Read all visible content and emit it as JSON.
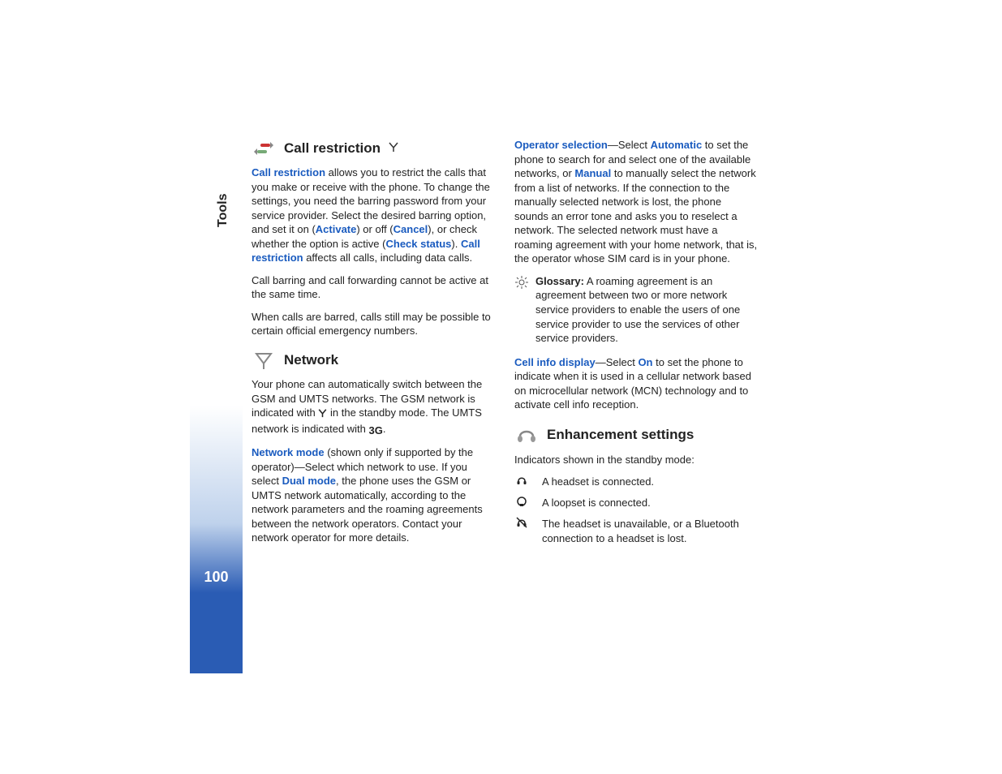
{
  "sidebar": {
    "section_label": "Tools",
    "page_number": "100"
  },
  "left_col": {
    "h1": "Call restriction",
    "p1_lead": "Call restriction",
    "p1_a": " allows you to restrict the calls that you make or receive with the phone. To change the settings, you need the barring password from your service provider. Select the desired barring option, and set it on (",
    "p1_activate": "Activate",
    "p1_b": ") or off (",
    "p1_cancel": "Cancel",
    "p1_c": "), or check whether the option is active (",
    "p1_check": "Check status",
    "p1_d": "). ",
    "p1_restr2": "Call restriction",
    "p1_e": " affects all calls, including data calls.",
    "p2": "Call barring and call forwarding cannot be active at the same time.",
    "p3": "When calls are barred, calls still may be possible to certain official emergency numbers.",
    "h2": "Network",
    "p4_a": "Your phone can automatically switch between the GSM and UMTS networks. The GSM network is indicated with ",
    "p4_b": " in the standby mode. The UMTS network is indicated with ",
    "p4_3g": "3G",
    "p4_c": ".",
    "p5_lead": "Network mode",
    "p5_a": " (shown only if supported by the operator)—Select which network to use. If you select ",
    "p5_dual": "Dual mode",
    "p5_b": ", the phone uses the GSM or UMTS network automatically, according to the network parameters and the roaming agreements between the network operators. Contact your network operator for more details."
  },
  "right_col": {
    "p1_lead": "Operator selection",
    "p1_a": "—Select ",
    "p1_auto": "Automatic",
    "p1_b": " to set the phone to search for and select one of the available networks, or ",
    "p1_manual": "Manual",
    "p1_c": " to manually select the network from a list of networks. If the connection to the manually selected network is lost, the phone sounds an error tone and asks you to reselect a network. The selected network must have a roaming agreement with your home network, that is, the operator whose SIM card is in your phone.",
    "gloss_label": "Glossary:",
    "gloss_text": " A roaming agreement is an agreement between two or more network service providers to enable the users of one service provider to use the services of other service providers.",
    "p2_lead": "Cell info display",
    "p2_a": "—Select ",
    "p2_on": "On",
    "p2_b": " to set the phone to indicate when it is used in a cellular network based on microcellular network (MCN) technology and to activate cell info reception.",
    "h1": "Enhancement settings",
    "ind_intro": "Indicators shown in the standby mode:",
    "ind1": "A headset is connected.",
    "ind2": "A loopset is connected.",
    "ind3": "The headset is unavailable, or a Bluetooth connection to a headset is lost."
  }
}
